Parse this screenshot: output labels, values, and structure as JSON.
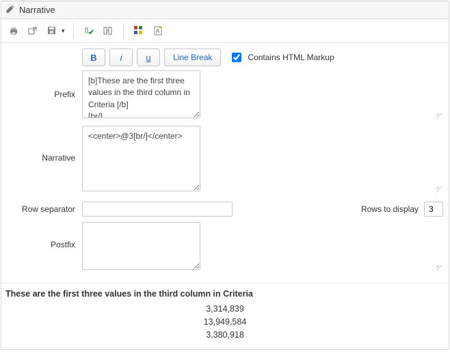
{
  "header": {
    "title": "Narrative"
  },
  "toolbar": {
    "print": "print-icon",
    "export": "export-icon",
    "save_menu": "save-icon",
    "refresh_tick": "refresh-tick-icon",
    "columns": "columns-icon",
    "colors": "colors-icon",
    "insert": "insert-icon"
  },
  "editor": {
    "bold": "B",
    "italic": "i",
    "underline": "u",
    "line_break": "Line Break",
    "contains_html_label": "Contains HTML Markup",
    "contains_html_checked": true
  },
  "fields": {
    "prefix_label": "Prefix",
    "prefix_value": "[b]These are the first three values in the third column in Criteria [/b]\n[br/]",
    "narrative_label": "Narrative",
    "narrative_value": "<center>@3[br/]</center>",
    "row_separator_label": "Row separator",
    "row_separator_value": "",
    "rows_to_display_label": "Rows to display",
    "rows_to_display_value": "3",
    "postfix_label": "Postfix",
    "postfix_value": ""
  },
  "preview": {
    "heading": "These are the first three values in the third column in Criteria",
    "rows": [
      "3,314,839",
      "13,949,584",
      "3,380,918"
    ]
  }
}
